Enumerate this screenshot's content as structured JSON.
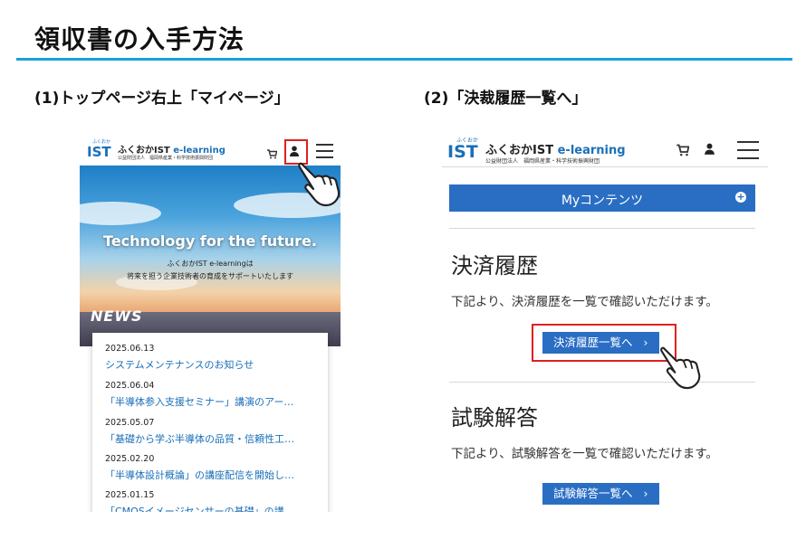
{
  "page": {
    "title": "領収書の入手方法",
    "step1": "(1)トップページ右上「マイページ」",
    "step2": "(2)「決裁履歴一覧へ」"
  },
  "site": {
    "logo_small": "ふくおか",
    "logo_ist": "IST",
    "logo_name": "ふくおかIST",
    "logo_elearning": "e-learning",
    "logo_sub": "公益財団法人　福岡県産業・科学技術振興財団"
  },
  "left_phone": {
    "hero_title": "Technology for the future.",
    "hero_sub1": "ふくおかIST e-learningは",
    "hero_sub2": "将来を担う企業技術者の育成をサポートいたします",
    "news_label": "NEWS",
    "news": [
      {
        "date": "2025.06.13",
        "text": "システムメンテナンスのお知らせ"
      },
      {
        "date": "2025.06.04",
        "text": "「半導体参入支援セミナー」講演のアー…"
      },
      {
        "date": "2025.05.07",
        "text": "「基礎から学ぶ半導体の品質・信頼性工…"
      },
      {
        "date": "2025.02.20",
        "text": "「半導体設計概論」の講座配信を開始し…"
      },
      {
        "date": "2025.01.15",
        "text": "「CMOSイメージセンサーの基礎」の講…"
      }
    ]
  },
  "right_phone": {
    "mycontents": "Myコンテンツ",
    "mycontents_plus": "+",
    "sec1_heading": "決済履歴",
    "sec1_text": "下記より、決済履歴を一覧で確認いただけます。",
    "sec1_button": "決済履歴一覧へ",
    "sec2_heading": "試験解答",
    "sec2_text": "下記より、試験解答を一覧で確認いただけます。",
    "sec2_button": "試験解答一覧へ",
    "arrow": "›"
  },
  "colors": {
    "accent": "#1aa1da",
    "brand_blue": "#2a6ec4",
    "highlight_red": "#e02020"
  }
}
